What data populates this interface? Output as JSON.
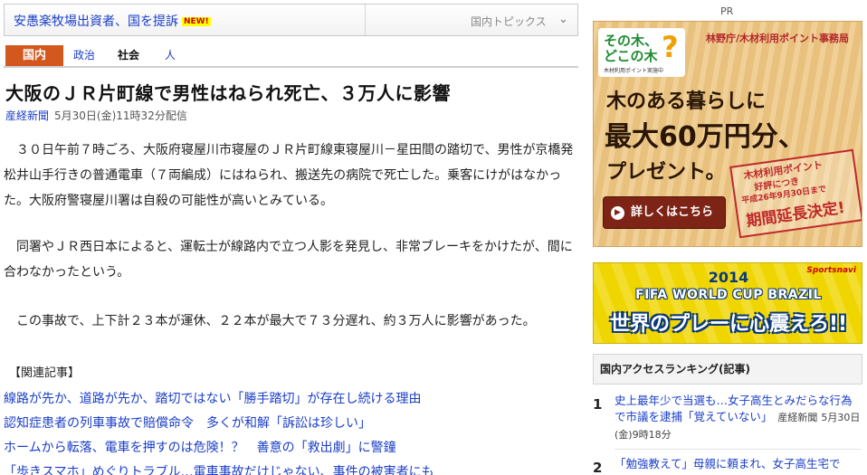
{
  "topbar": {
    "headline": "安愚楽牧場出資者、国を提訴",
    "new_badge": "NEW!",
    "topics_label": "国内トピックス",
    "chevron_glyph": "⌄"
  },
  "tabs": [
    {
      "label": "国内",
      "active": true
    },
    {
      "label": "政治",
      "active": false
    },
    {
      "label": "社会",
      "active": false
    },
    {
      "label": "人",
      "active": false
    }
  ],
  "article": {
    "title": "大阪のＪＲ片町線で男性はねられ死亡、３万人に影響",
    "source": "産経新聞",
    "date": "5月30日(金)11時32分配信",
    "paragraphs": [
      "　３０日午前７時ごろ、大阪府寝屋川市寝屋のＪＲ片町線東寝屋川－星田間の踏切で、男性が京橋発松井山手行きの普通電車（７両編成）にはねられ、搬送先の病院で死亡した。乗客にけがはなかった。大阪府警寝屋川署は自殺の可能性が高いとみている。",
      "　同署やＪＲ西日本によると、運転士が線路内で立つ人影を発見し、非常ブレーキをかけたが、間に合わなかったという。",
      "　この事故で、上下計２３本が運休、２２本が最大で７３分遅れ、約３万人に影響があった。"
    ]
  },
  "related": {
    "heading": "【関連記事】",
    "links": [
      "線路が先か、道路が先か、踏切ではない「勝手踏切」が存在し続ける理由",
      "認知症患者の列車事故で賠償命令　多くが和解「訴訟は珍しい」",
      "ホームから転落、電車を押すのは危険！？　善意の「救出劇」に警鐘",
      "「歩きスマホ」めぐりトラブル…電車事故だけじゃない、事件の被害者にも"
    ]
  },
  "sidebar": {
    "pr_label": "PR",
    "ad_wood": {
      "logo_line1": "その木、",
      "logo_line2": "どこの木",
      "logo_mark": "?",
      "logo_sub": "木材利用ポイント実施中",
      "org": "林野庁/木材利用ポイント事務局",
      "line1": "木のある暮らしに",
      "line2": "最大60万円分、",
      "line3": "プレゼント。",
      "stamp_line1": "木材利用ポイント",
      "stamp_line2": "好評につき",
      "stamp_line3": "平成26年9月30日まで",
      "stamp_line4": "期間延長決定!",
      "button_label": "詳しくはこちら",
      "button_arrow": "▶",
      "colors": {
        "background": "#eec987",
        "button": "#7d2417",
        "accent": "#c0282a"
      }
    },
    "ad_worldcup": {
      "brand": "Sportsnavi",
      "year": "2014",
      "title": "FIFA WORLD CUP BRAZIL",
      "tagline": "世界のプレーに心震えろ!!",
      "colors": {
        "background": "#f0d600",
        "text_outline": "#0b3a7a"
      }
    },
    "ranking": {
      "heading": "国内アクセスランキング(記事)",
      "items": [
        {
          "rank": "1",
          "title": "史上最年少で当選も…女子高生とみだらな行為で市議を逮捕「覚えていない」",
          "source": "産経新聞",
          "time": "5月30日(金)9時18分"
        },
        {
          "rank": "2",
          "title": "「勉強教えて」母親に頼まれ、女子高生宅で",
          "source": "",
          "time": ""
        }
      ]
    }
  }
}
